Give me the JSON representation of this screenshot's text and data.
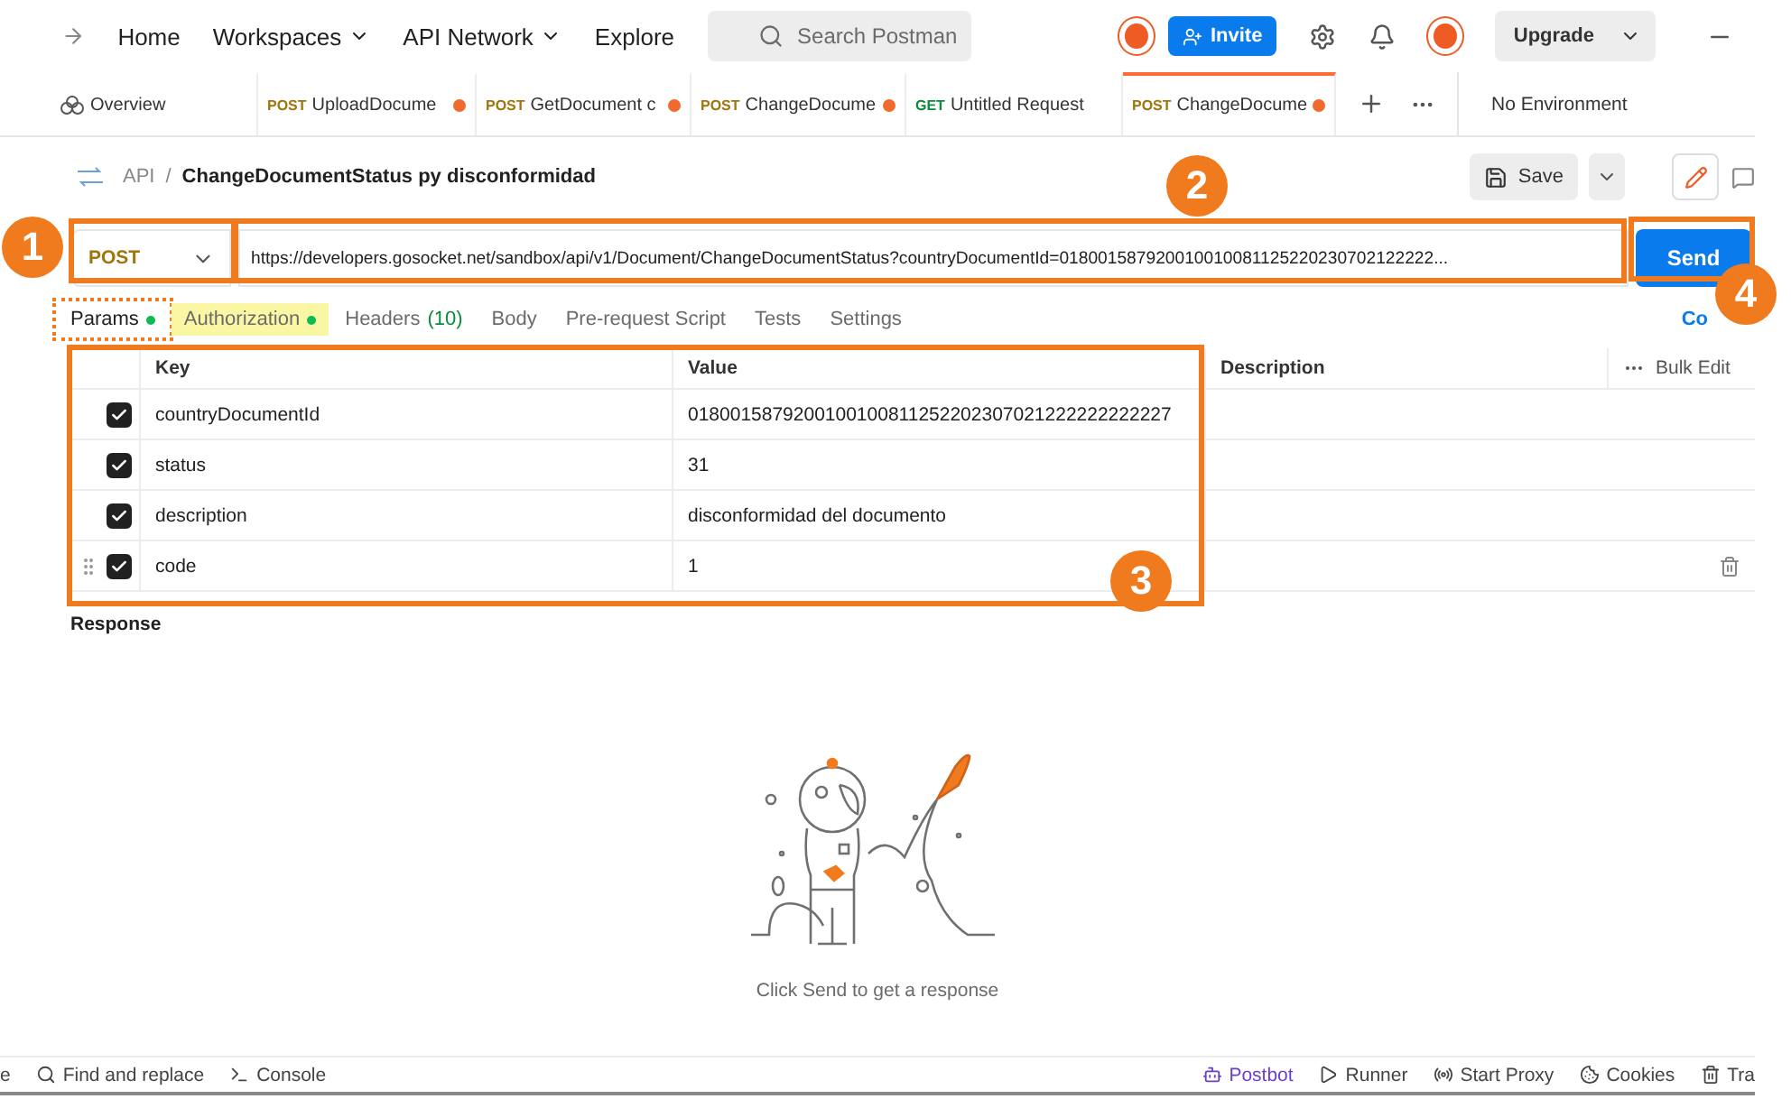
{
  "nav": {
    "items": [
      {
        "label": "Home",
        "dropdown": false
      },
      {
        "label": "Workspaces",
        "dropdown": true
      },
      {
        "label": "API Network",
        "dropdown": true
      },
      {
        "label": "Explore",
        "dropdown": false
      }
    ],
    "search": {
      "placeholder": "Search Postman"
    },
    "invite": "Invite",
    "upgrade": "Upgrade"
  },
  "tabs": [
    {
      "kind": "overview",
      "label": "Overview",
      "selected": false
    },
    {
      "kind": "request",
      "method": "POST",
      "label": "UploadDocume",
      "selected": false,
      "unsaved": true
    },
    {
      "kind": "request",
      "method": "POST",
      "label": "GetDocument c",
      "selected": false,
      "unsaved": true
    },
    {
      "kind": "request",
      "method": "POST",
      "label": "ChangeDocume",
      "selected": false,
      "unsaved": true
    },
    {
      "kind": "request",
      "method": "GET",
      "label": "Untitled Request",
      "selected": false,
      "unsaved": false
    },
    {
      "kind": "request",
      "method": "POST",
      "label": "ChangeDocume",
      "selected": true,
      "unsaved": true
    }
  ],
  "environment": "No Environment",
  "breadcrumb": {
    "parent": "API",
    "separator": "/",
    "title": "ChangeDocumentStatus py disconformidad"
  },
  "save": "Save",
  "request": {
    "method": "POST",
    "url": "https://developers.gosocket.net/sandbox/api/v1/Document/ChangeDocumentStatus?countryDocumentId=018001587920010010081125220230702122222...",
    "send": "Send"
  },
  "subtabs": [
    {
      "label": "Params",
      "dot": true,
      "selected": true,
      "highlighted": false,
      "outlined": true
    },
    {
      "label": "Authorization",
      "dot": true,
      "selected": false,
      "highlighted": true,
      "outlined": false
    },
    {
      "label": "Headers",
      "count": "(10)",
      "dot": false,
      "selected": false,
      "highlighted": false,
      "outlined": false
    },
    {
      "label": "Body",
      "dot": false,
      "selected": false,
      "highlighted": false,
      "outlined": false
    },
    {
      "label": "Pre-request Script",
      "dot": false,
      "selected": false,
      "highlighted": false,
      "outlined": false
    },
    {
      "label": "Tests",
      "dot": false,
      "selected": false,
      "highlighted": false,
      "outlined": false
    },
    {
      "label": "Settings",
      "dot": false,
      "selected": false,
      "highlighted": false,
      "outlined": false
    }
  ],
  "subtabs_right": "Co",
  "params": {
    "columns": [
      "Key",
      "Value",
      "Description"
    ],
    "bulk_edit": "Bulk Edit",
    "rows": [
      {
        "checked": true,
        "key": "countryDocumentId",
        "value": "0180015879200100100811252202307021222222222227",
        "hovered": false
      },
      {
        "checked": true,
        "key": "status",
        "value": "31",
        "hovered": false
      },
      {
        "checked": true,
        "key": "description",
        "value": "disconformidad del documento",
        "hovered": false
      },
      {
        "checked": true,
        "key": "code",
        "value": "1",
        "hovered": true
      }
    ]
  },
  "response": {
    "label": "Response",
    "empty_text": "Click Send to get a response"
  },
  "status_bar": {
    "left": [
      {
        "kind": "cut",
        "label": "e"
      },
      {
        "kind": "search",
        "label": "Find and replace"
      },
      {
        "kind": "console",
        "label": "Console"
      }
    ],
    "right": [
      {
        "kind": "postbot",
        "label": "Postbot"
      },
      {
        "kind": "runner",
        "label": "Runner"
      },
      {
        "kind": "proxy",
        "label": "Start Proxy"
      },
      {
        "kind": "cookies",
        "label": "Cookies"
      },
      {
        "kind": "trash",
        "label": "Tra"
      }
    ]
  },
  "callouts": [
    {
      "number": "1"
    },
    {
      "number": "2"
    },
    {
      "number": "3"
    },
    {
      "number": "4"
    }
  ]
}
